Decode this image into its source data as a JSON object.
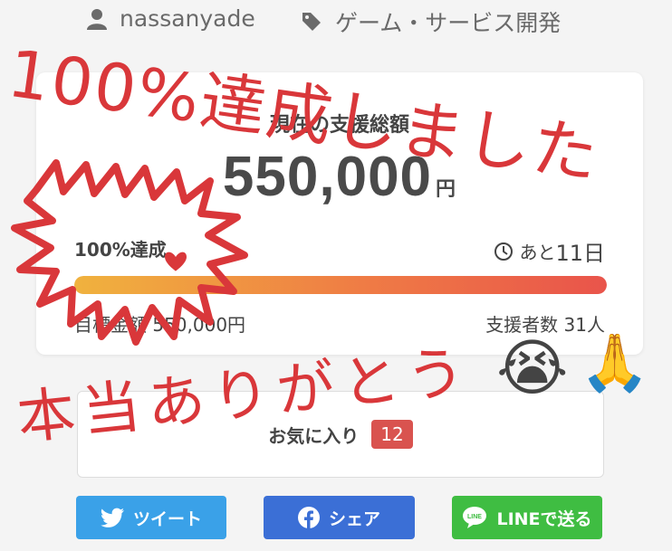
{
  "meta": {
    "owner": "nassanyade",
    "category": "ゲーム・サービス開発",
    "owner_icon": "user-icon",
    "category_icon": "tag-icon"
  },
  "funding": {
    "label": "現在の支援総額",
    "amount": "550,000",
    "currency": "円",
    "percent_label": "100%達成",
    "progress": 1.0,
    "remaining_prefix": "あと",
    "remaining_value": "11日",
    "goal_text": "目標金額 550,000円",
    "backers_text": "支援者数 31人"
  },
  "favorite": {
    "label": "お気に入り",
    "count": "12"
  },
  "share": {
    "twitter": "ツイート",
    "facebook": "シェア",
    "line": "LINEで送る"
  },
  "overlay": {
    "top_text": "100%達成しました",
    "bottom_text": "本当ありがとう",
    "emoji1": "😭",
    "emoji2": "🙏"
  },
  "colors": {
    "accent_red": "#d9373a",
    "twitter": "#3aa1e8",
    "facebook": "#3b6fd6",
    "line": "#3fbd42"
  }
}
